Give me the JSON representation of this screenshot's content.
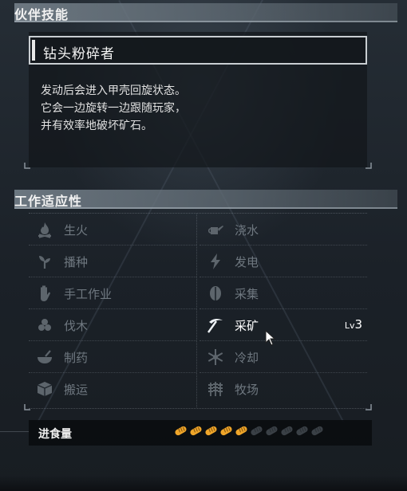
{
  "partner_skill": {
    "header": "伙伴技能",
    "name": "钻头粉碎者",
    "description_lines": [
      "发动后会进入甲壳回旋状态。",
      "它会一边旋转一边跟随玩家，",
      "并有效率地破坏矿石。"
    ]
  },
  "work_suitability": {
    "header": "工作适应性",
    "items": [
      {
        "label": "生火",
        "icon": "fire-icon",
        "active": false
      },
      {
        "label": "浇水",
        "icon": "watering-can-icon",
        "active": false
      },
      {
        "label": "播种",
        "icon": "sprout-icon",
        "active": false
      },
      {
        "label": "发电",
        "icon": "lightning-icon",
        "active": false
      },
      {
        "label": "手工作业",
        "icon": "hand-icon",
        "active": false
      },
      {
        "label": "采集",
        "icon": "leaf-icon",
        "active": false
      },
      {
        "label": "伐木",
        "icon": "logs-icon",
        "active": false
      },
      {
        "label": "采矿",
        "icon": "pickaxe-icon",
        "active": true,
        "level_prefix": "Lv",
        "level": "3"
      },
      {
        "label": "制药",
        "icon": "mortar-bowl-icon",
        "active": false
      },
      {
        "label": "冷却",
        "icon": "snowflake-icon",
        "active": false
      },
      {
        "label": "搬运",
        "icon": "box-icon",
        "active": false
      },
      {
        "label": "牧场",
        "icon": "wheat-icon",
        "active": false
      }
    ]
  },
  "food": {
    "label": "进食量",
    "filled": 5,
    "total": 10,
    "icon": "bread-icon",
    "filled_color": "#f0a62a",
    "empty_color": "#3a4046"
  },
  "colors": {
    "active_text": "#ffffff",
    "inactive_text": "#6f7880",
    "panel_bg": "#12161b"
  }
}
